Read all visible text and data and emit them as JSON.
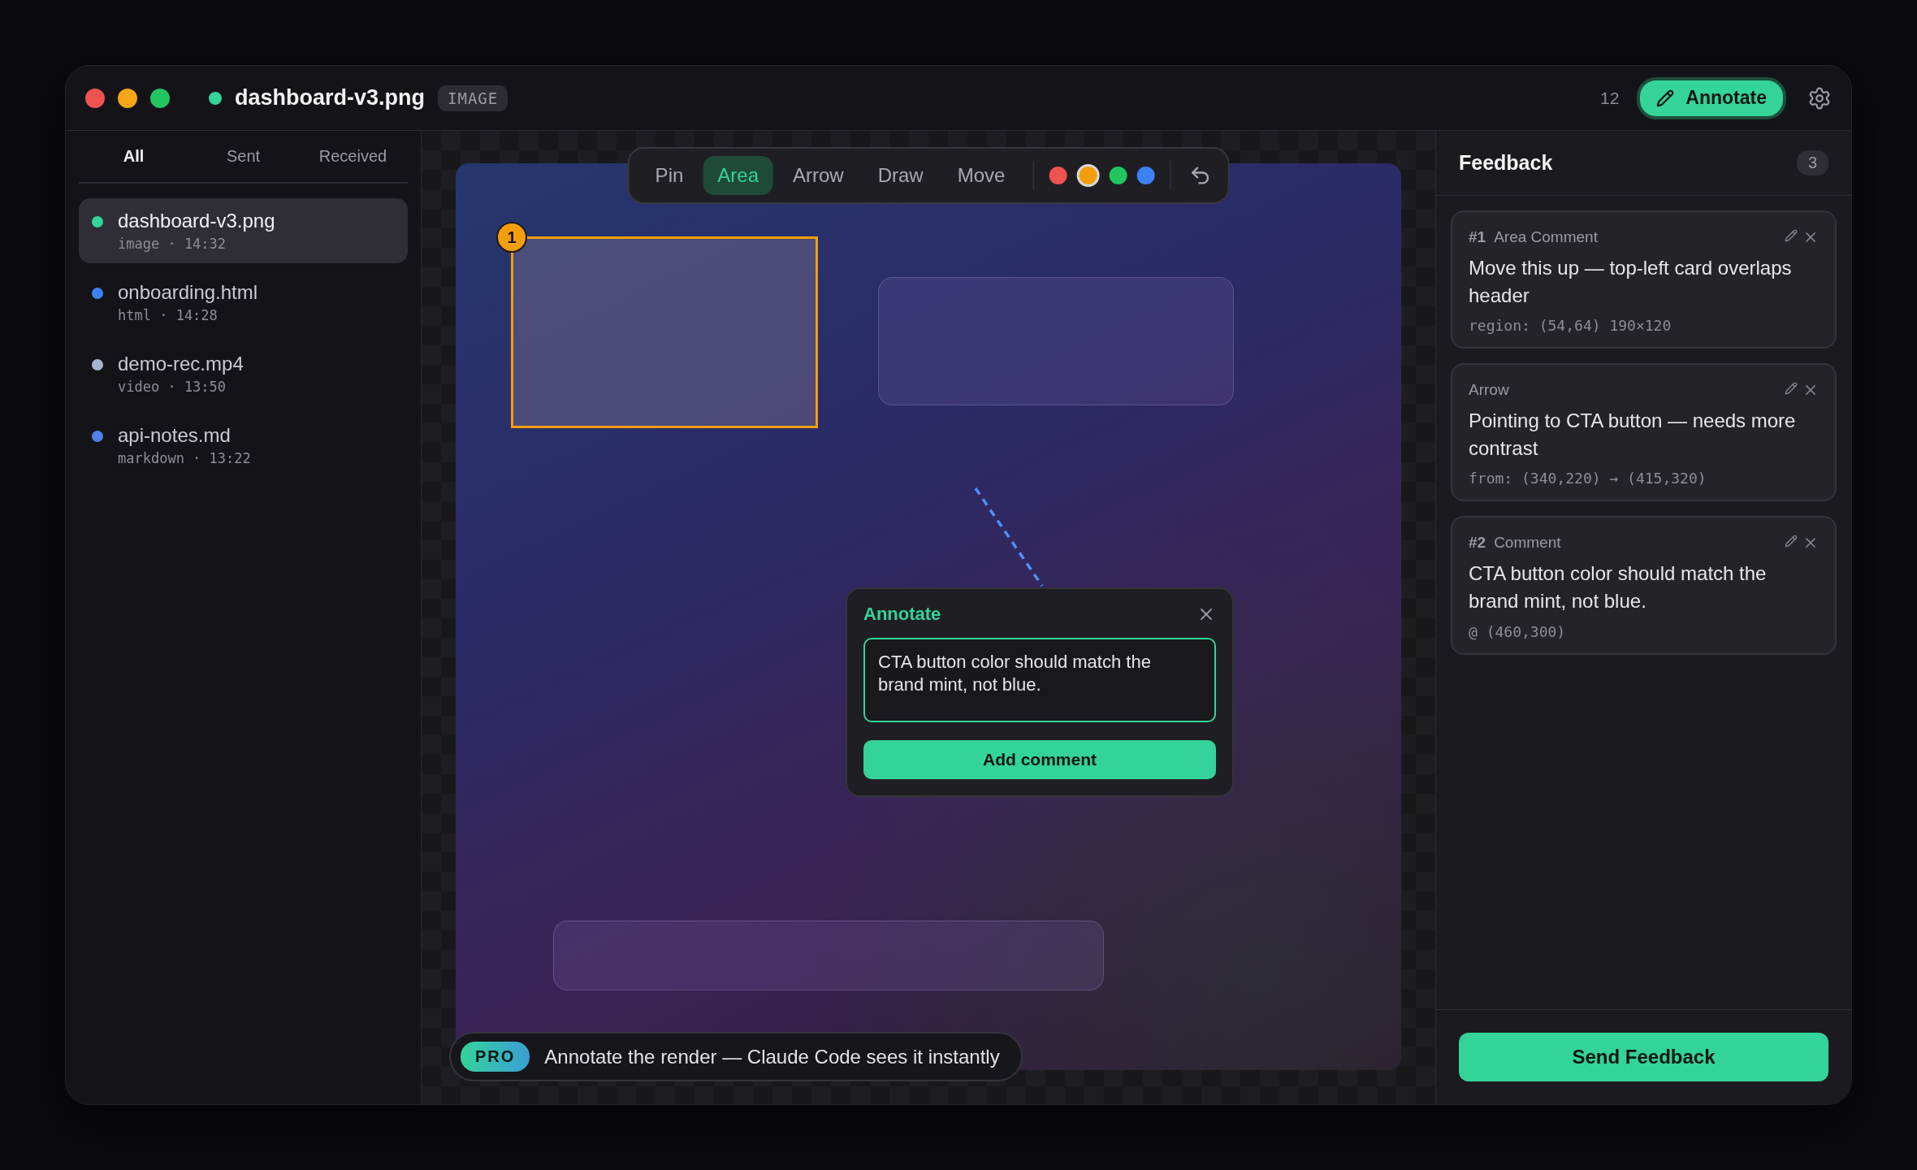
{
  "window": {
    "title": "dashboard-v3.png",
    "type_badge": "IMAGE",
    "counter": "12",
    "annotate_button": "Annotate"
  },
  "sidebar": {
    "tabs": [
      {
        "label": "All",
        "selected": true
      },
      {
        "label": "Sent",
        "selected": false
      },
      {
        "label": "Received",
        "selected": false
      }
    ],
    "files": [
      {
        "name": "dashboard-v3.png",
        "meta": "image · 14:32",
        "color": "#34d399",
        "selected": true
      },
      {
        "name": "onboarding.html",
        "meta": "html · 14:28",
        "color": "#3b82f6",
        "selected": false
      },
      {
        "name": "demo-rec.mp4",
        "meta": "video · 13:50",
        "color": "#a5b4cf",
        "selected": false
      },
      {
        "name": "api-notes.md",
        "meta": "markdown · 13:22",
        "color": "#4f7fe8",
        "selected": false
      }
    ]
  },
  "toolbar": {
    "tools": [
      {
        "label": "Pin",
        "selected": false
      },
      {
        "label": "Area",
        "selected": true
      },
      {
        "label": "Arrow",
        "selected": false
      },
      {
        "label": "Draw",
        "selected": false
      },
      {
        "label": "Move",
        "selected": false
      }
    ],
    "colors": [
      {
        "color": "#ef5350",
        "selected": false
      },
      {
        "color": "#f59e0b",
        "selected": true
      },
      {
        "color": "#22c55e",
        "selected": false
      },
      {
        "color": "#3b82f6",
        "selected": false
      }
    ]
  },
  "canvas": {
    "area_marker": "1",
    "popup": {
      "title": "Annotate",
      "value": "CTA button color should match the brand mint, not blue.",
      "button": "Add comment"
    },
    "banner": {
      "badge": "PRO",
      "text": "Annotate the render — Claude Code sees it instantly"
    }
  },
  "feedback": {
    "title": "Feedback",
    "count": "3",
    "items": [
      {
        "number": "#1",
        "type": "Area Comment",
        "text": "Move this up — top-left card overlaps header",
        "detail": "region: (54,64) 190×120"
      },
      {
        "type": "Arrow",
        "text": "Pointing to CTA button — needs more contrast",
        "detail": "from: (340,220) → (415,320)"
      },
      {
        "number": "#2",
        "type": "Comment",
        "text": "CTA button color should match the brand mint, not blue.",
        "detail": "@ (460,300)"
      }
    ],
    "send_button": "Send Feedback"
  }
}
